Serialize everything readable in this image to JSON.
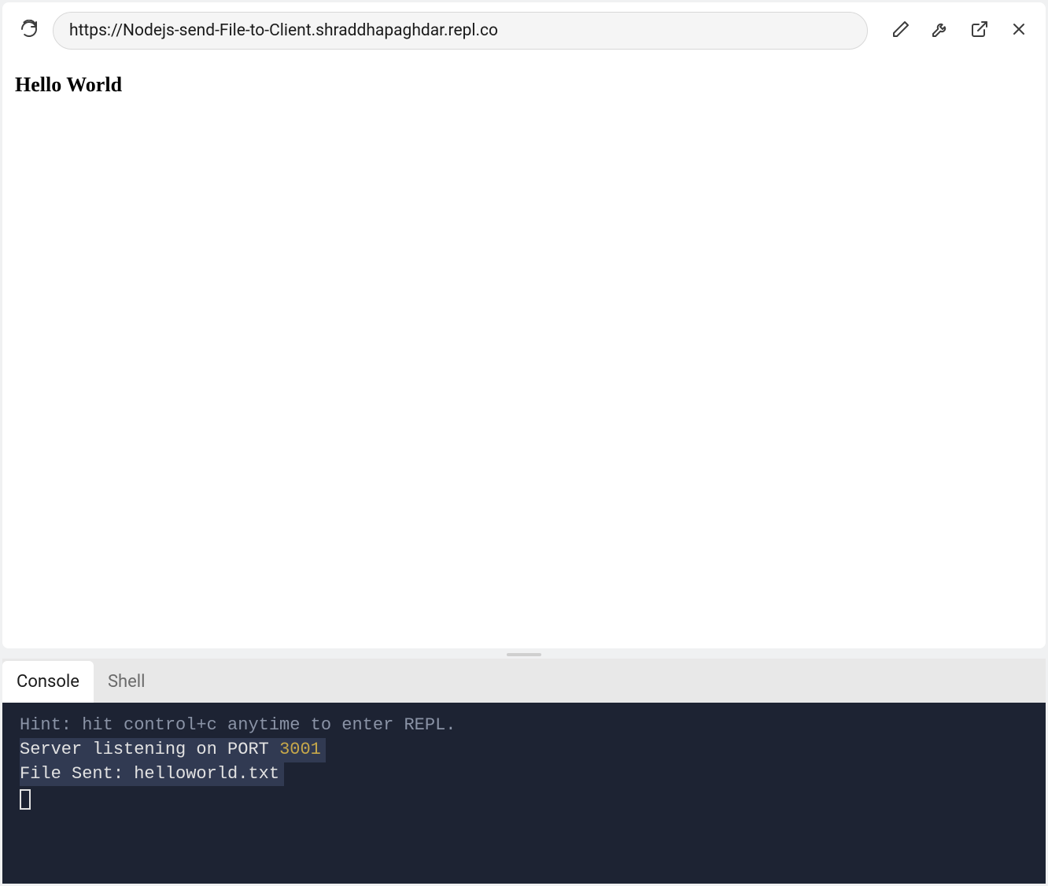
{
  "toolbar": {
    "url": "https://Nodejs-send-File-to-Client.shraddhapaghdar.repl.co"
  },
  "page": {
    "heading": "Hello World"
  },
  "tabs": {
    "console": "Console",
    "shell": "Shell"
  },
  "console": {
    "hint": "Hint: hit control+c anytime to enter REPL.",
    "line2_prefix": "Server listening on PORT ",
    "line2_port": "3001",
    "line3": "File Sent: helloworld.txt"
  }
}
